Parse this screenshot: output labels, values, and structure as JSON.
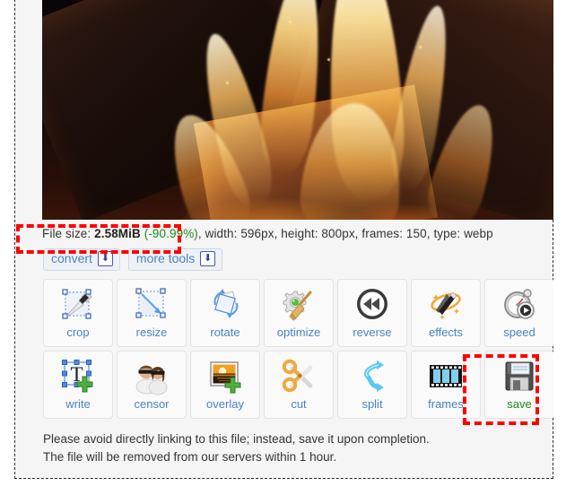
{
  "preview": {
    "alt": "animated-webp-preview-fireplace-flames",
    "description": "Looping fireplace video preview with burning logs and orange flames"
  },
  "file_info": {
    "label": "File size:",
    "size": "2.58MiB",
    "reduction": "(-90.99%)",
    "rest": ", width: 596px, height: 800px, frames: 150, type: webp",
    "reduction_color": "#1a8a1a"
  },
  "sub_buttons": [
    {
      "label": "convert",
      "icon": "download-arrow-icon",
      "glyph": "⬇"
    },
    {
      "label": "more tools",
      "icon": "download-arrow-icon",
      "glyph": "⬇"
    }
  ],
  "tools": [
    {
      "label": "crop",
      "icon": "crop-icon"
    },
    {
      "label": "resize",
      "icon": "resize-icon"
    },
    {
      "label": "rotate",
      "icon": "rotate-icon"
    },
    {
      "label": "optimize",
      "icon": "optimize-icon"
    },
    {
      "label": "reverse",
      "icon": "reverse-icon"
    },
    {
      "label": "effects",
      "icon": "effects-icon"
    },
    {
      "label": "speed",
      "icon": "speed-icon"
    },
    {
      "label": "write",
      "icon": "write-text-icon"
    },
    {
      "label": "censor",
      "icon": "censor-icon"
    },
    {
      "label": "overlay",
      "icon": "overlay-image-icon"
    },
    {
      "label": "cut",
      "icon": "scissors-cut-icon"
    },
    {
      "label": "split",
      "icon": "split-icon"
    },
    {
      "label": "frames",
      "icon": "film-frames-icon"
    },
    {
      "label": "save",
      "icon": "floppy-save-icon",
      "highlighted": true
    }
  ],
  "notes": {
    "line1": "Please avoid directly linking to this file; instead, save it upon completion.",
    "line2": "The file will be removed from our servers within 1 hour."
  },
  "annotations": {
    "filesize_box": "highlight-file-size",
    "save_box": "highlight-save-button",
    "color": "#ff0000"
  }
}
